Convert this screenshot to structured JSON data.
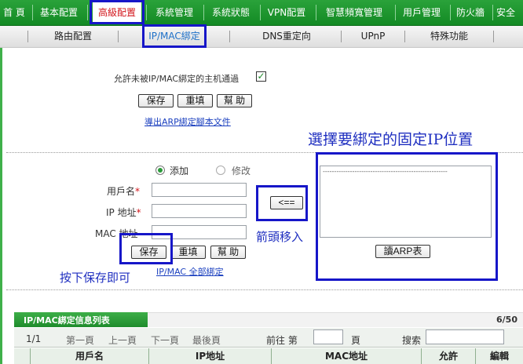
{
  "topnav": {
    "items": [
      {
        "label": "首 頁"
      },
      {
        "label": "基本配置"
      },
      {
        "label": "高級配置"
      },
      {
        "label": "系統管理"
      },
      {
        "label": "系統狀態"
      },
      {
        "label": "VPN配置"
      },
      {
        "label": "智慧頻寬管理"
      },
      {
        "label": "用戶管理"
      },
      {
        "label": "防火牆"
      },
      {
        "label": "安全"
      }
    ]
  },
  "subnav": {
    "items": [
      {
        "label": "路由配置"
      },
      {
        "label": "IP/MAC綁定"
      },
      {
        "label": "DNS重定向"
      },
      {
        "label": "UPnP"
      },
      {
        "label": "特殊功能"
      }
    ]
  },
  "allow_section": {
    "checkbox_label": "允許未被IP/MAC綁定的主机通過",
    "save": "保存",
    "reset": "重填",
    "help": "幫 助",
    "export_link": "導出ARP綁定腳本文件"
  },
  "form": {
    "mode_add": "添加",
    "mode_edit": "修改",
    "username_label": "用戶名",
    "ip_label": "IP 地址",
    "mac_label": "MAC 地址",
    "required_mark": "*",
    "arrow_button": "<==",
    "save": "保存",
    "reset": "重填",
    "help": "幫 助",
    "bind_all_link": "IP/MAC 全部綁定",
    "read_arp_button": "讀ARP表",
    "arp_list_placeholder": "-------------------------------------------------------"
  },
  "annotations": {
    "select_fixed_ip": "選擇要綁定的固定IP位置",
    "arrow_move": "箭頭移入",
    "press_save": "按下保存即可"
  },
  "table": {
    "title": "IP/MAC綁定信息列表",
    "count": "6/50",
    "page_info": "1/1",
    "first": "第一頁",
    "prev": "上一頁",
    "next": "下一頁",
    "last": "最後頁",
    "goto_prefix": "前往 第",
    "goto_suffix": "頁",
    "search_label": "搜索",
    "columns": [
      "用戶名",
      "IP地址",
      "MAC地址",
      "允許",
      "編輯"
    ]
  },
  "colors": {
    "nav_green": "#1f9a30",
    "active_red": "#d2141a",
    "annotation_blue": "#1616c8",
    "link_blue": "#1a3fbf"
  }
}
